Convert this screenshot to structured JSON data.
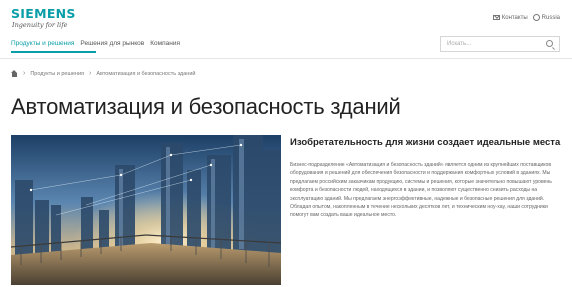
{
  "brand": {
    "name": "SIEMENS",
    "tagline": "Ingenuity for life",
    "accent_color": "#0a9fa8"
  },
  "utility": {
    "contacts_label": "Контакты",
    "contacts_icon": "mail-icon",
    "region_label": "Russia",
    "region_icon": "globe-icon"
  },
  "nav": {
    "items": [
      {
        "label": "Продукты и решения",
        "active": true
      },
      {
        "label": "Решения для рынков",
        "active": false
      },
      {
        "label": "Компания",
        "active": false
      }
    ]
  },
  "search": {
    "placeholder": "Искать...",
    "icon": "search-icon"
  },
  "breadcrumb": {
    "home_icon": "home-icon",
    "items": [
      "Продукты и решения",
      "Автоматизация и безопасность зданий"
    ]
  },
  "page": {
    "title": "Автоматизация и безопасность зданий",
    "subtitle": "Изобретательность для жизни создает идеальные места",
    "body": "Бизнес-подразделение «Автоматизация и безопасность зданий» является одним из крупнейших поставщиков оборудования и решений для обеспечения безопасности и поддержания комфортных условий в зданиях. Мы предлагаем российским заказчикам продукцию, системы и решения, которые значительно повышают уровень комфорта и безопасности людей, находящихся в здании, и позволяют существенно снизить расходы на эксплуатацию зданий. Мы предлагаем энергоэффективные, надежные и безопасные решения для зданий. Обладая опытом, накопленным в течение нескольких десятков лет, и техническим ноу-хау, наши сотрудники помогут вам создать ваше идеальное место."
  }
}
